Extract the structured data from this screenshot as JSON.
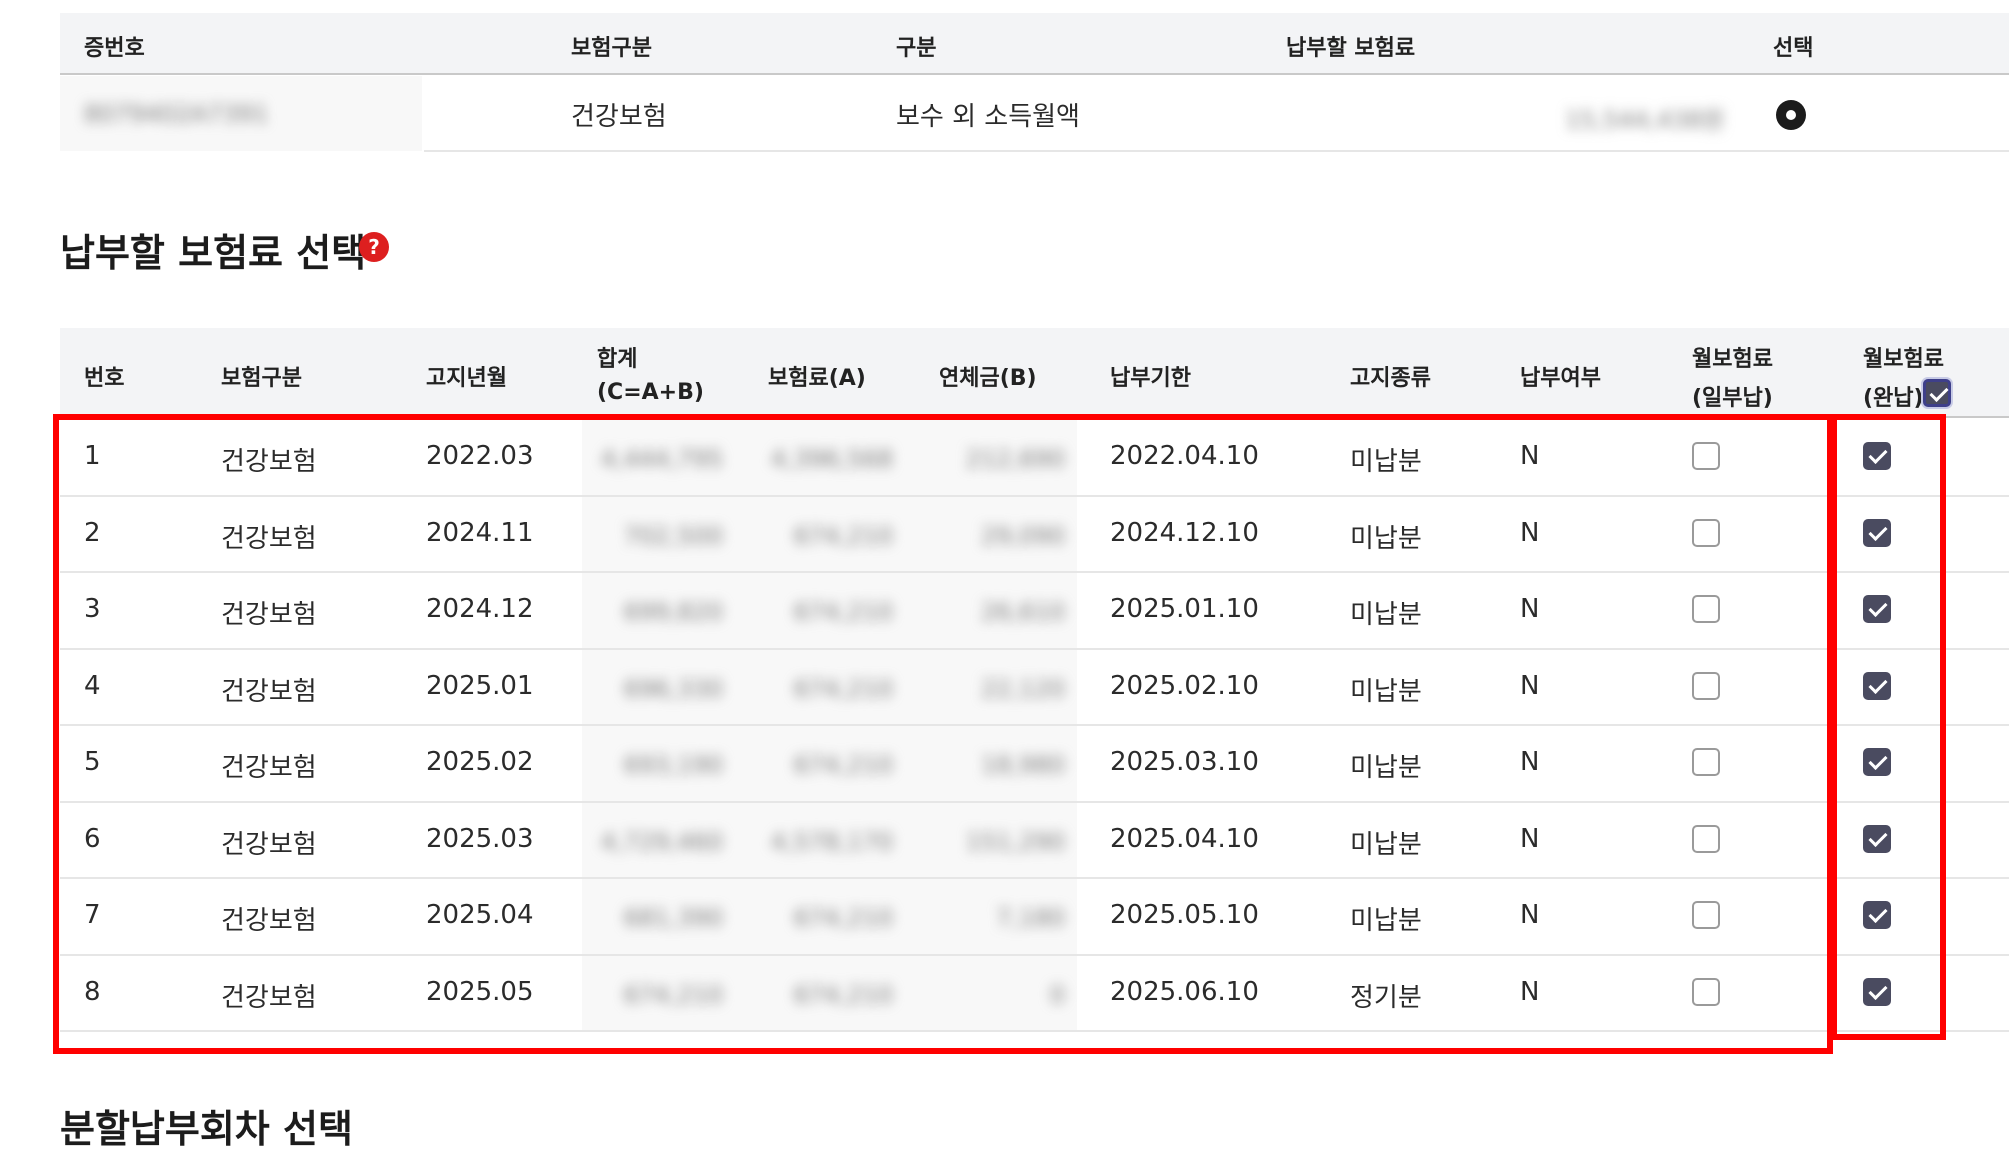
{
  "policy_table": {
    "headers": {
      "policy_no": "증번호",
      "insurance_type": "보험구분",
      "category": "구분",
      "amount_due": "납부할 보험료",
      "select": "선택"
    },
    "row": {
      "policy_no": "8079402A7391",
      "insurance_type": "건강보험",
      "category": "보수 외 소득월액",
      "amount_due": "15,544,438원",
      "selected": true
    }
  },
  "premium_section": {
    "title": "납부할 보험료 선택",
    "help_icon": "?"
  },
  "premium_table": {
    "headers": {
      "no": "번호",
      "insurance_type": "보험구분",
      "notice_month": "고지년월",
      "total_line1": "합계",
      "total_line2": "(C=A+B)",
      "premium": "보험료(A)",
      "late_fee": "연체금(B)",
      "due_date": "납부기한",
      "notice_type": "고지종류",
      "paid": "납부여부",
      "partial_line1": "월보험료",
      "partial_line2": "(일부납)",
      "full_line1": "월보험료",
      "full_line2": "(완납)"
    },
    "select_all_full": true,
    "rows": [
      {
        "no": "1",
        "type": "건강보험",
        "month": "2022.03",
        "total": "4,444,795",
        "premium": "4,396,568",
        "late": "212,690",
        "due": "2022.04.10",
        "notice": "미납분",
        "paid": "N",
        "partial": false,
        "full": true
      },
      {
        "no": "2",
        "type": "건강보험",
        "month": "2024.11",
        "total": "702,500",
        "premium": "674,210",
        "late": "29,090",
        "due": "2024.12.10",
        "notice": "미납분",
        "paid": "N",
        "partial": false,
        "full": true
      },
      {
        "no": "3",
        "type": "건강보험",
        "month": "2024.12",
        "total": "699,820",
        "premium": "674,210",
        "late": "26,610",
        "due": "2025.01.10",
        "notice": "미납분",
        "paid": "N",
        "partial": false,
        "full": true
      },
      {
        "no": "4",
        "type": "건강보험",
        "month": "2025.01",
        "total": "696,330",
        "premium": "674,210",
        "late": "22,120",
        "due": "2025.02.10",
        "notice": "미납분",
        "paid": "N",
        "partial": false,
        "full": true
      },
      {
        "no": "5",
        "type": "건강보험",
        "month": "2025.02",
        "total": "693,190",
        "premium": "674,210",
        "late": "18,980",
        "due": "2025.03.10",
        "notice": "미납분",
        "paid": "N",
        "partial": false,
        "full": true
      },
      {
        "no": "6",
        "type": "건강보험",
        "month": "2025.03",
        "total": "4,729,460",
        "premium": "4,578,170",
        "late": "151,290",
        "due": "2025.04.10",
        "notice": "미납분",
        "paid": "N",
        "partial": false,
        "full": true
      },
      {
        "no": "7",
        "type": "건강보험",
        "month": "2025.04",
        "total": "681,390",
        "premium": "674,210",
        "late": "7,180",
        "due": "2025.05.10",
        "notice": "미납분",
        "paid": "N",
        "partial": false,
        "full": true
      },
      {
        "no": "8",
        "type": "건강보험",
        "month": "2025.05",
        "total": "674,210",
        "premium": "674,210",
        "late": "0",
        "due": "2025.06.10",
        "notice": "정기분",
        "paid": "N",
        "partial": false,
        "full": true
      }
    ]
  },
  "installment_section": {
    "title": "분할납부회차 선택"
  },
  "highlight_color": "#ff0000"
}
